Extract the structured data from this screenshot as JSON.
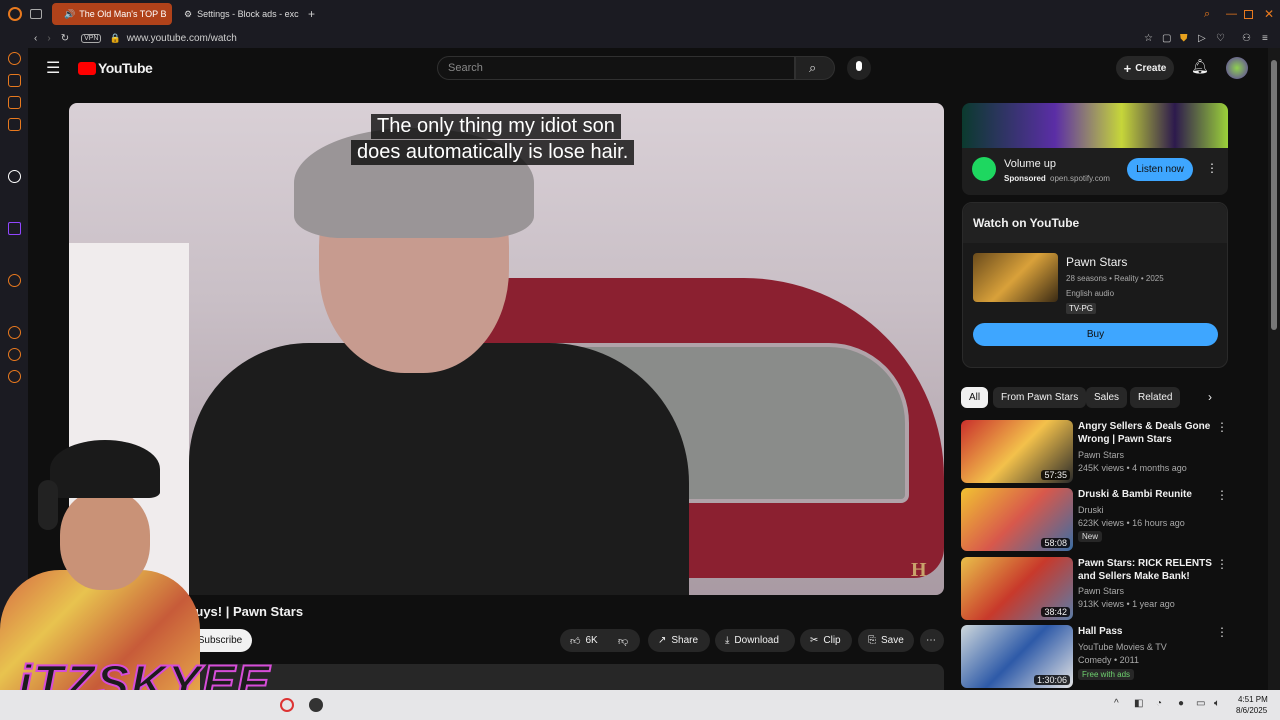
{
  "browser": {
    "tabs": [
      {
        "label": "The Old Man's TOP B",
        "active": true
      },
      {
        "label": "Settings - Block ads - exc",
        "active": false
      }
    ],
    "vpn": "VPN",
    "url": "www.youtube.com/watch",
    "accent": "#e8791e"
  },
  "youtube": {
    "logo": "YouTube",
    "search_placeholder": "Search",
    "create_label": "Create"
  },
  "video": {
    "caption_line1": "The only thing my idiot son",
    "caption_line2": "does automatically is lose hair.",
    "title_partial": "Buys! | Pawn Stars",
    "subscribe_label": "Subscribe",
    "likes": "6K",
    "share": "Share",
    "download": "Download",
    "clip": "Clip",
    "save": "Save"
  },
  "overlay": {
    "brand_text": "iTZSKYEE"
  },
  "ad": {
    "title": "Volume up",
    "sponsored": "Sponsored",
    "domain": "open.spotify.com",
    "cta": "Listen now"
  },
  "watch_on_youtube": {
    "heading": "Watch on YouTube",
    "show": "Pawn Stars",
    "meta": "28 seasons • Reality • 2025",
    "audio": "English audio",
    "rating": "TV-PG",
    "buy": "Buy"
  },
  "chips": [
    "All",
    "From Pawn Stars",
    "Sales",
    "Related"
  ],
  "recommendations": [
    {
      "title": "Angry Sellers & Deals Gone Wrong | Pawn Stars",
      "channel": "Pawn Stars",
      "stats": "245K views • 4 months ago",
      "duration": "57:35",
      "badge": ""
    },
    {
      "title": "Druski & Bambi Reunite",
      "channel": "Druski",
      "stats": "623K views • 16 hours ago",
      "duration": "58:08",
      "badge": "New"
    },
    {
      "title": "Pawn Stars: RICK RELENTS and Sellers Make Bank!",
      "channel": "Pawn Stars",
      "stats": "913K views • 1 year ago",
      "duration": "38:42",
      "badge": ""
    },
    {
      "title": "Hall Pass",
      "channel": "YouTube Movies & TV",
      "stats": "Comedy • 2011",
      "duration": "1:30:06",
      "badge": "Free with ads"
    }
  ],
  "taskbar": {
    "time": "4:51 PM",
    "date": "8/6/2025"
  }
}
